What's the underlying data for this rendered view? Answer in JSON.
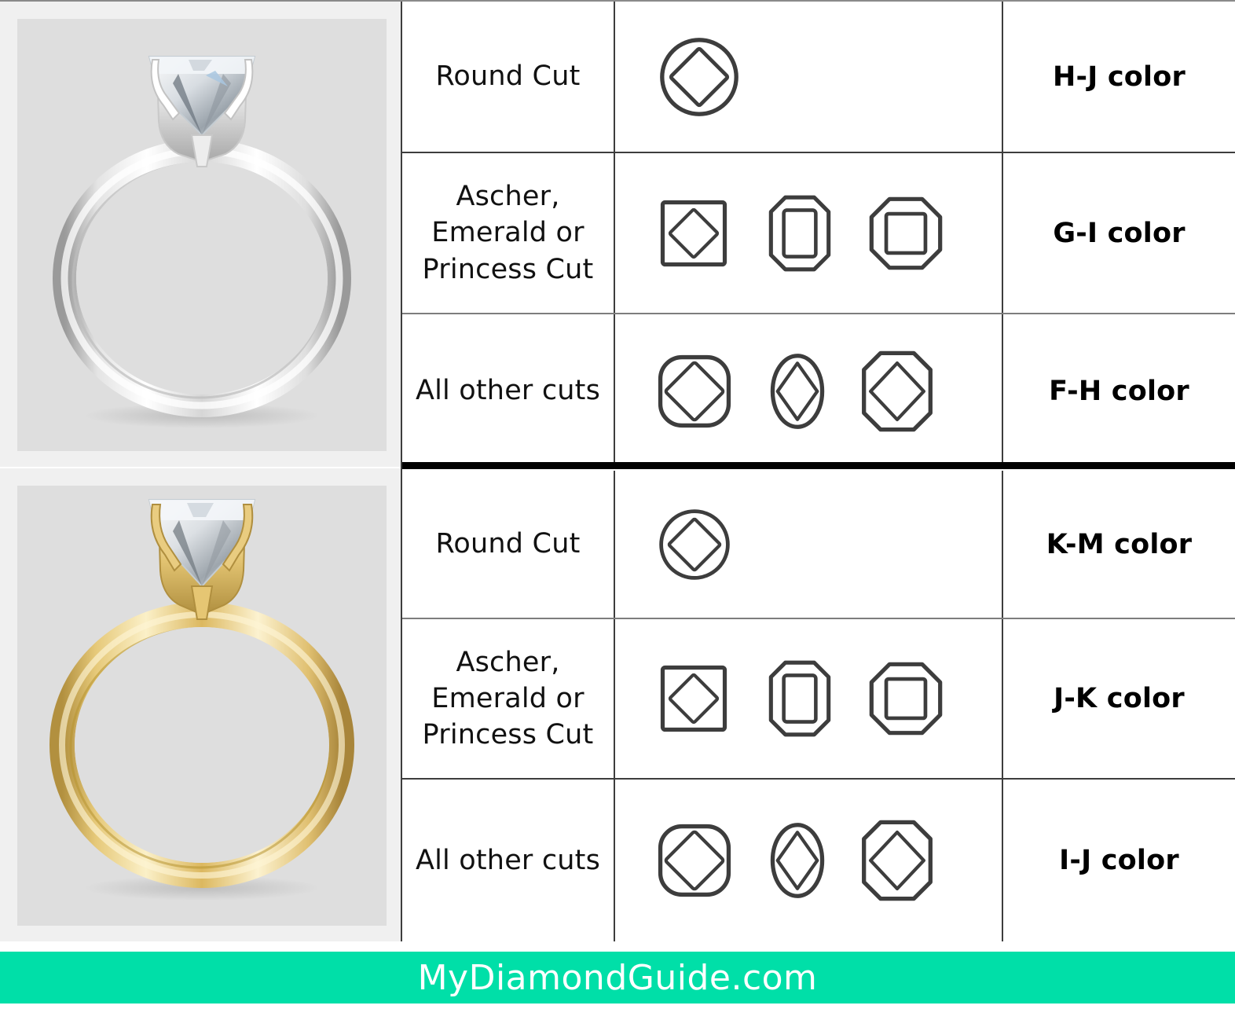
{
  "footer": {
    "text": "MyDiamondGuide.com",
    "background_color": "#00DFA8",
    "text_color": "#FFFFFF"
  },
  "sections": [
    {
      "id": "white-gold",
      "metal": "white-gold-ring",
      "metal_label": "White gold solitaire engagement ring with round brilliant diamond",
      "rows": [
        {
          "cut_label": "Round Cut",
          "shapes": [
            "round"
          ],
          "color_grade": "H-J color"
        },
        {
          "cut_label": "Ascher, Emerald or Princess Cut",
          "shapes": [
            "princess",
            "emerald",
            "asscher"
          ],
          "color_grade": "G-I color"
        },
        {
          "cut_label": "All other cuts",
          "shapes": [
            "cushion",
            "oval",
            "radiant"
          ],
          "color_grade": "F-H color"
        }
      ]
    },
    {
      "id": "yellow-gold",
      "metal": "yellow-gold-ring",
      "metal_label": "Yellow gold solitaire engagement ring with round brilliant diamond",
      "rows": [
        {
          "cut_label": "Round Cut",
          "shapes": [
            "round"
          ],
          "color_grade": "K-M color"
        },
        {
          "cut_label": "Ascher, Emerald or Princess Cut",
          "shapes": [
            "princess",
            "emerald",
            "asscher"
          ],
          "color_grade": "J-K color"
        },
        {
          "cut_label": "All other cuts",
          "shapes": [
            "cushion",
            "oval",
            "radiant"
          ],
          "color_grade": "I-J color"
        }
      ]
    }
  ],
  "colors": {
    "stroke": "#3d3d3d",
    "grid_line": "#7d7d7d",
    "panel_background": "#F0F0F0",
    "photo_background": "#DEDEDE",
    "white_gold": "#F3F3F3",
    "yellow_gold": "#E8C66A",
    "accent": "#00DFA8"
  }
}
